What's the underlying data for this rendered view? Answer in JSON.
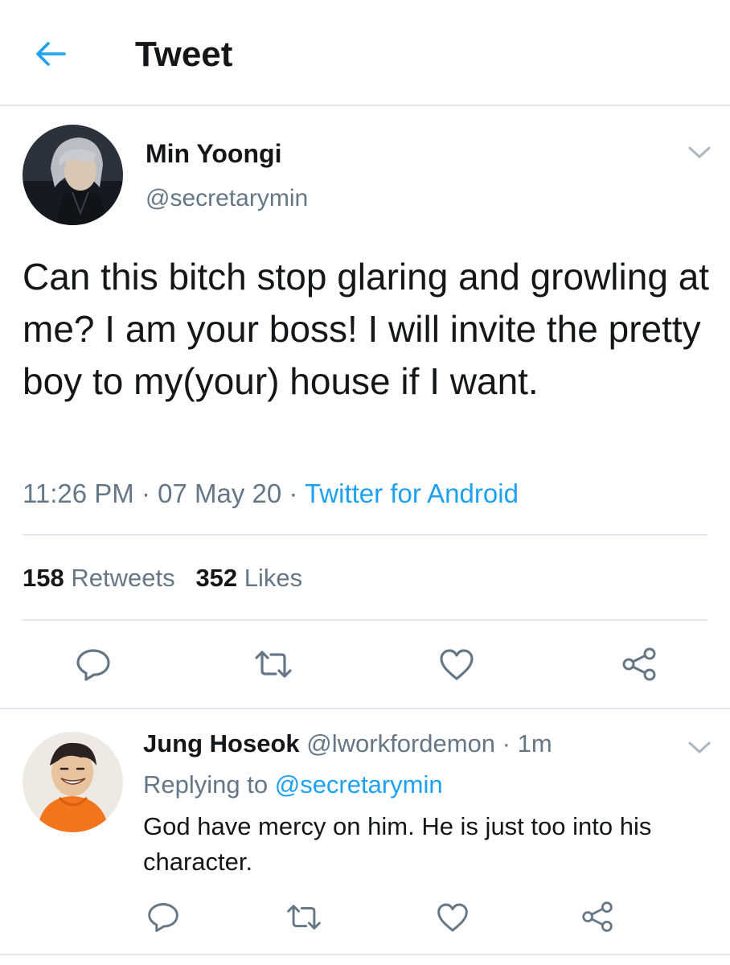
{
  "header": {
    "title": "Tweet",
    "back_icon": "arrow-left-icon",
    "accent": "#1da1f2"
  },
  "tweet": {
    "author_name": "Min Yoongi",
    "author_handle": "@secretarymin",
    "text": "Can this bitch stop glaring and growling at me? I am your boss! I will invite the pretty boy to my(your) house if I want.",
    "time": "11:26 PM",
    "date": "07 May 20",
    "separator": " · ",
    "source": "Twitter for Android",
    "retweets_count": "158",
    "retweets_label": "Retweets",
    "likes_count": "352",
    "likes_label": "Likes",
    "actions": [
      "reply-icon",
      "retweet-icon",
      "like-icon",
      "share-icon"
    ]
  },
  "reply": {
    "author_name": "Jung Hoseok",
    "author_handle": "@lworkfordemon",
    "separator": " · ",
    "time_ago": "1m",
    "replying_label": "Replying to",
    "replying_to": "@secretarymin",
    "text": "God have mercy on him. He is just too into his character.",
    "actions": [
      "reply-icon",
      "retweet-icon",
      "like-icon",
      "share-icon"
    ]
  },
  "colors": {
    "text": "#14171a",
    "secondary": "#657786",
    "link": "#1da1f2",
    "divider": "#e1e8ed"
  }
}
